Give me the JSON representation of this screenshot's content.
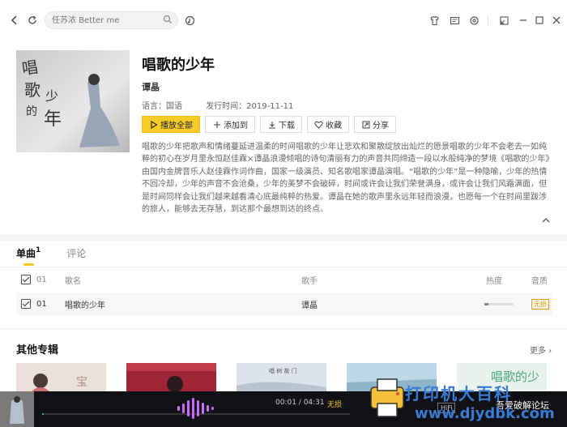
{
  "header": {
    "search_placeholder": "任苏浓 Better me"
  },
  "album": {
    "title": "唱歌的少年",
    "artist": "谭晶",
    "language_label": "语言：国语",
    "release_label": "发行时间：2019-11-11",
    "cover_text": "唱歌的少年",
    "description": "唱歌的少年把歌声和情绪蔓延进温柔的时间唱歌的少年让悲欢和聚散绽放出灿烂的愿景唱歌的少年不会老去一如纯粹的初心在岁月里永恒赵佳霖×谭晶浪漫倾唱的诗句清丽有力的声音共同缔造一段以水般纯净的梦境《唱歌的少年》由国内金牌音乐人赵佳霖作词作曲，国家一级演员、知名歌唱家谭晶演唱。“唱歌的少年”是一种隐喻，少年的热情不回冷却，少年的声音不会沧桑，少年的美梦不会破碎，时间或许会让我们荣誉满身，或许会让我们风霜满面，但是时间同样会让我们越来越看清心底最纯粹的热爱。谭晶在她的歌声里永远年轻而浪漫，也愿每一个在时间里跋涉的旅人，能够去无存慧，到达那个最想到达的终点。"
  },
  "actions": {
    "play_all": "播放全部",
    "add_to": "添加到",
    "download": "下载",
    "favorite": "收藏",
    "share": "分享"
  },
  "tabs": {
    "songs_label": "单曲",
    "songs_count": "1",
    "comments_label": "评论"
  },
  "table": {
    "header": {
      "index": "01",
      "name": "歌名",
      "artist": "歌手",
      "heat": "热度",
      "quality": "音质"
    },
    "rows": [
      {
        "index": "01",
        "name": "唱歌的少年",
        "artist": "谭晶",
        "heat": 0.15,
        "quality": "无损"
      }
    ]
  },
  "other_albums": {
    "title": "其他专辑",
    "more": "更多 ›"
  },
  "player": {
    "time": "00:01 / 04:31",
    "quality": "无损",
    "hifi": "HiFi",
    "progress": 0.004
  },
  "watermark": {
    "line1": "打印机大百科",
    "line2": "吾爱破解论坛",
    "url": "www.djydbk.com"
  },
  "colors": {
    "accent": "#f7cb27",
    "player_bg": "#101114",
    "wave": "#c66dff"
  }
}
